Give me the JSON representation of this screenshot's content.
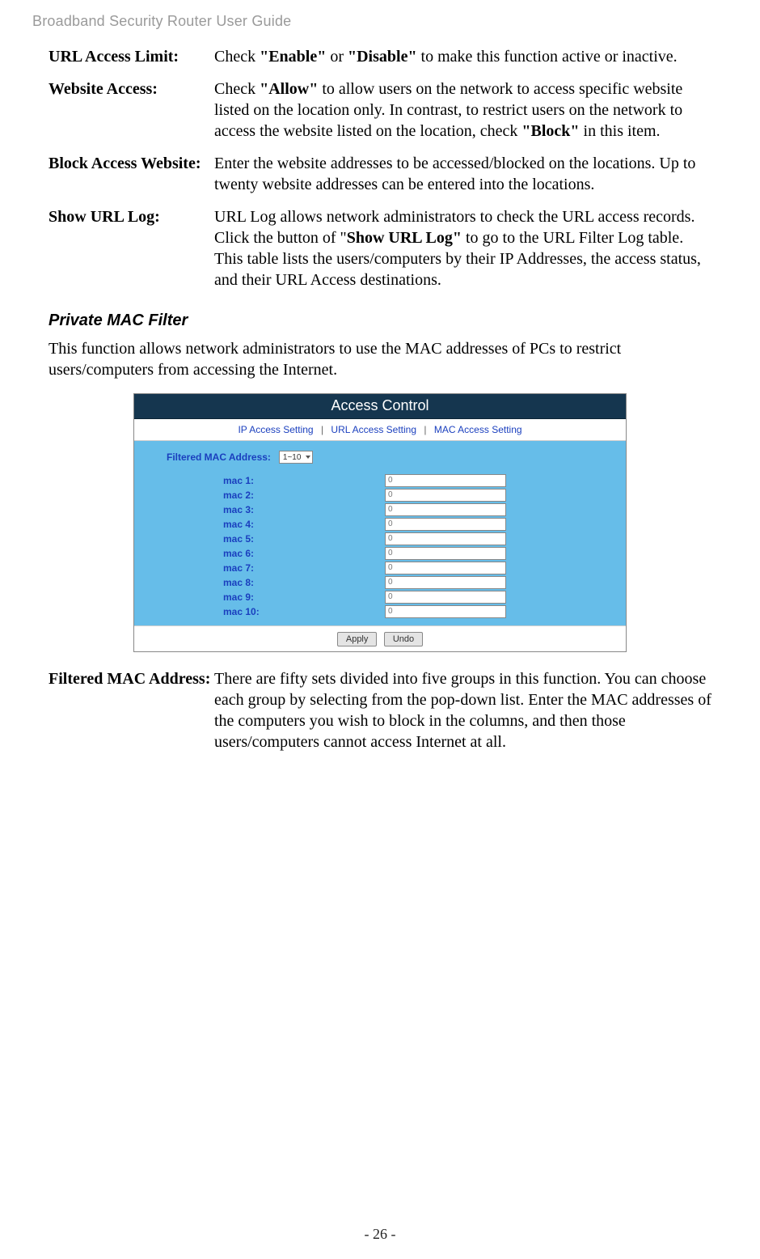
{
  "header": "Broadband Security Router User Guide",
  "page_number": "- 26 -",
  "definitions1": [
    {
      "label": "URL Access Limit:",
      "parts": [
        {
          "t": "Check ",
          "b": false
        },
        {
          "t": "\"Enable\"",
          "b": true
        },
        {
          "t": " or ",
          "b": false
        },
        {
          "t": "\"Disable\"",
          "b": true
        },
        {
          "t": " to make this function active or inactive.",
          "b": false
        }
      ]
    },
    {
      "label": "Website Access:",
      "parts": [
        {
          "t": "Check ",
          "b": false
        },
        {
          "t": "\"Allow\"",
          "b": true
        },
        {
          "t": " to allow users on the network to access specific website listed on the location only. In contrast, to restrict users on the network to access the website listed on the location, check ",
          "b": false
        },
        {
          "t": "\"Block\"",
          "b": true
        },
        {
          "t": " in this item.",
          "b": false
        }
      ]
    },
    {
      "label": "Block Access Website:",
      "parts": [
        {
          "t": "Enter the website addresses to be accessed/blocked on the locations. Up to twenty website addresses can be entered into the locations.",
          "b": false
        }
      ]
    },
    {
      "label": "Show URL Log:",
      "parts": [
        {
          "t": "URL Log allows network administrators to check the URL access records. Click the button of \"",
          "b": false
        },
        {
          "t": "Show URL Log\"",
          "b": true
        },
        {
          "t": " to go to the URL Filter Log table. This table lists the users/computers by their IP Addresses, the access status, and their URL Access destinations.",
          "b": false
        }
      ]
    }
  ],
  "section_title": "Private MAC Filter",
  "section_intro": "This function allows network administrators to use the MAC addresses of PCs to restrict users/computers from accessing the Internet.",
  "figure": {
    "title": "Access Control",
    "tabs": [
      "IP Access Setting",
      "URL Access Setting",
      "MAC Access Setting"
    ],
    "filter_label": "Filtered MAC Address:",
    "filter_value": "1~10",
    "mac_rows": [
      {
        "label": "mac 1:",
        "value": "0"
      },
      {
        "label": "mac 2:",
        "value": "0"
      },
      {
        "label": "mac 3:",
        "value": "0"
      },
      {
        "label": "mac 4:",
        "value": "0"
      },
      {
        "label": "mac 5:",
        "value": "0"
      },
      {
        "label": "mac 6:",
        "value": "0"
      },
      {
        "label": "mac 7:",
        "value": "0"
      },
      {
        "label": "mac 8:",
        "value": "0"
      },
      {
        "label": "mac 9:",
        "value": "0"
      },
      {
        "label": "mac 10:",
        "value": "0"
      }
    ],
    "buttons": {
      "apply": "Apply",
      "undo": "Undo"
    }
  },
  "definitions2": [
    {
      "label": "Filtered MAC Address:",
      "parts": [
        {
          "t": "There are fifty sets divided into five groups in this function. You can choose each group by selecting from the pop-down list. Enter the MAC addresses of the computers you wish to block in the columns, and then those users/computers cannot access Internet at all.",
          "b": false
        }
      ]
    }
  ]
}
